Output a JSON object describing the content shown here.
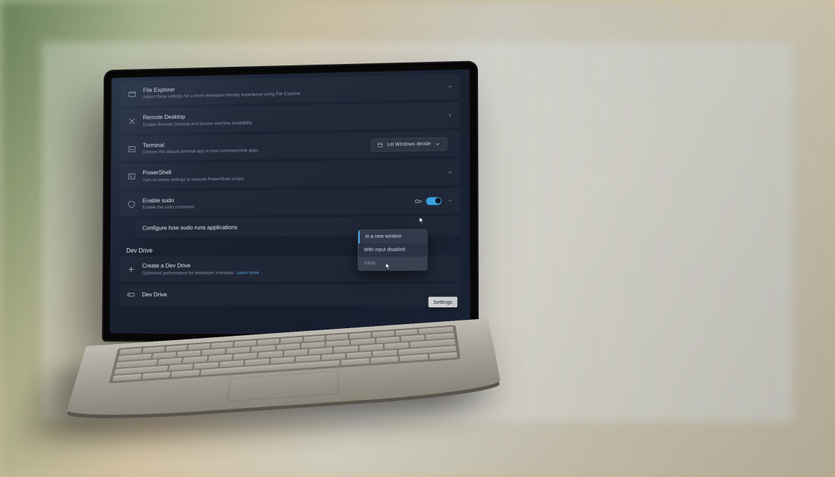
{
  "rows": {
    "file_explorer": {
      "title": "File Explorer",
      "desc": "Adjust these settings for a more developer-friendly experience using File Explorer"
    },
    "remote_desktop": {
      "title": "Remote Desktop",
      "desc": "Enable Remote Desktop and ensure machine availability"
    },
    "terminal": {
      "title": "Terminal",
      "desc": "Choose the default terminal app to host command-line apps",
      "selected": "Let Windows decide"
    },
    "powershell": {
      "title": "PowerShell",
      "desc": "Turn on these settings to execute PowerShell scripts"
    },
    "sudo": {
      "title": "Enable sudo",
      "desc": "Enable the sudo command",
      "toggle_label": "On"
    },
    "sudo_config": {
      "title": "Configure how sudo runs applications"
    },
    "dev_drive_create": {
      "title": "Create a Dev Drive",
      "desc": "Optimized performance for developer scenarios",
      "learn_more": "Learn more"
    },
    "dev_drive_item": {
      "title": "Dev Drive"
    }
  },
  "section": {
    "dev_drive": "Dev Drive"
  },
  "dropdown": {
    "opt1": "In a new window",
    "opt2": "With input disabled",
    "opt3": "Inline"
  },
  "tooltip": "Settings"
}
